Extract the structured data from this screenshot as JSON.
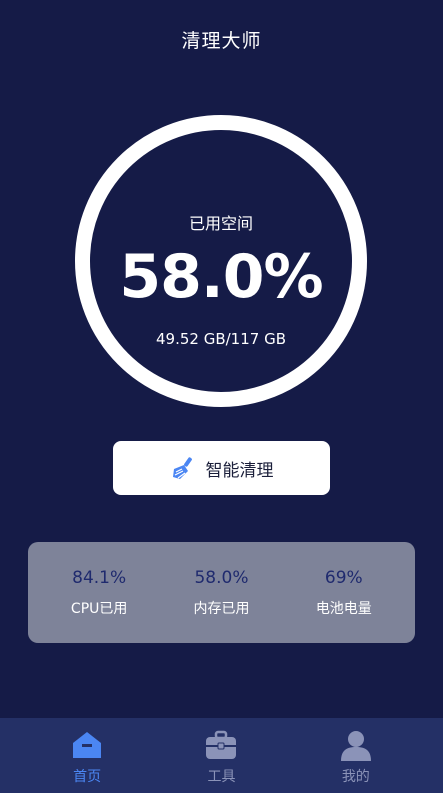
{
  "header": {
    "title": "清理大师"
  },
  "storage": {
    "label": "已用空间",
    "percent": "58.0%",
    "usage": "49.52 GB/117 GB"
  },
  "clean_button": {
    "icon": "broom-icon",
    "label": "智能清理"
  },
  "stats": [
    {
      "value": "84.1%",
      "label": "CPU已用"
    },
    {
      "value": "58.0%",
      "label": "内存已用"
    },
    {
      "value": "69%",
      "label": "电池电量"
    }
  ],
  "tabbar": {
    "items": [
      {
        "icon": "home-icon",
        "label": "首页",
        "active": true
      },
      {
        "icon": "toolbox-icon",
        "label": "工具",
        "active": false
      },
      {
        "icon": "user-icon",
        "label": "我的",
        "active": false
      }
    ]
  },
  "colors": {
    "background": "#151b47",
    "accent": "#4b86f3",
    "stats_value": "#1f2a6e",
    "stats_panel": "#7e8399",
    "tabbar": "#243066"
  }
}
